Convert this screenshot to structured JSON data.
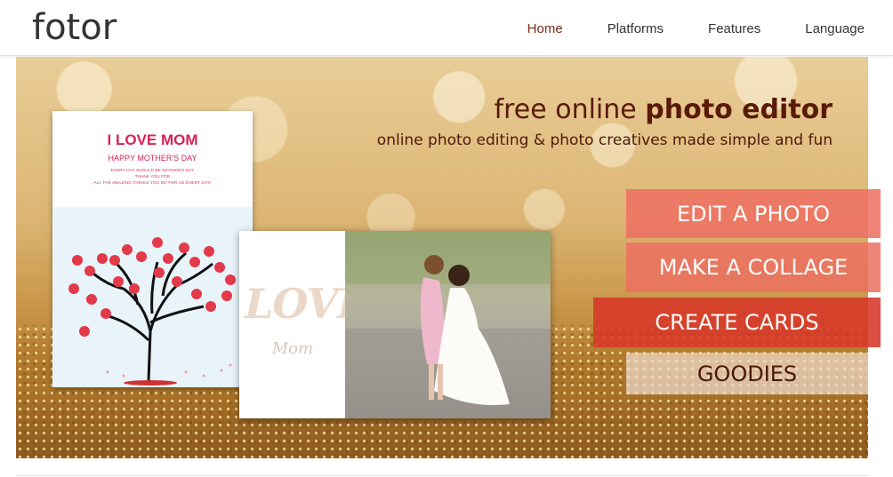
{
  "header": {
    "logo": "fotor",
    "nav": [
      {
        "label": "Home",
        "active": true
      },
      {
        "label": "Platforms",
        "active": false
      },
      {
        "label": "Features",
        "active": false
      },
      {
        "label": "Language",
        "active": false
      }
    ]
  },
  "hero": {
    "headline_light": "free online",
    "headline_bold": "photo editor",
    "subline": "online photo editing & photo creatives made simple and fun",
    "card1": {
      "title": "I LOVE MOM",
      "subtitle": "HAPPY MOTHER'S DAY",
      "line1": "EVERY DAY SHOULD BE MOTHER'S DAY",
      "line2": "THANK YOU FOR",
      "line3": "ALL THE AMAZING THINGS YOU DO FOR US EVERY DAY!"
    },
    "card2": {
      "love_text": "LOVE",
      "mom_text": "Mom"
    },
    "buttons": {
      "edit": "EDIT A PHOTO",
      "collage": "MAKE A COLLAGE",
      "cards": "CREATE CARDS",
      "goodies": "GOODIES"
    }
  },
  "colors": {
    "brand_text": "#333333",
    "active_nav": "#7a2a18",
    "headline": "#5a1a08",
    "card_pink": "#d6235a",
    "btn_coral": "#ee6e62",
    "btn_red": "#d73728"
  }
}
